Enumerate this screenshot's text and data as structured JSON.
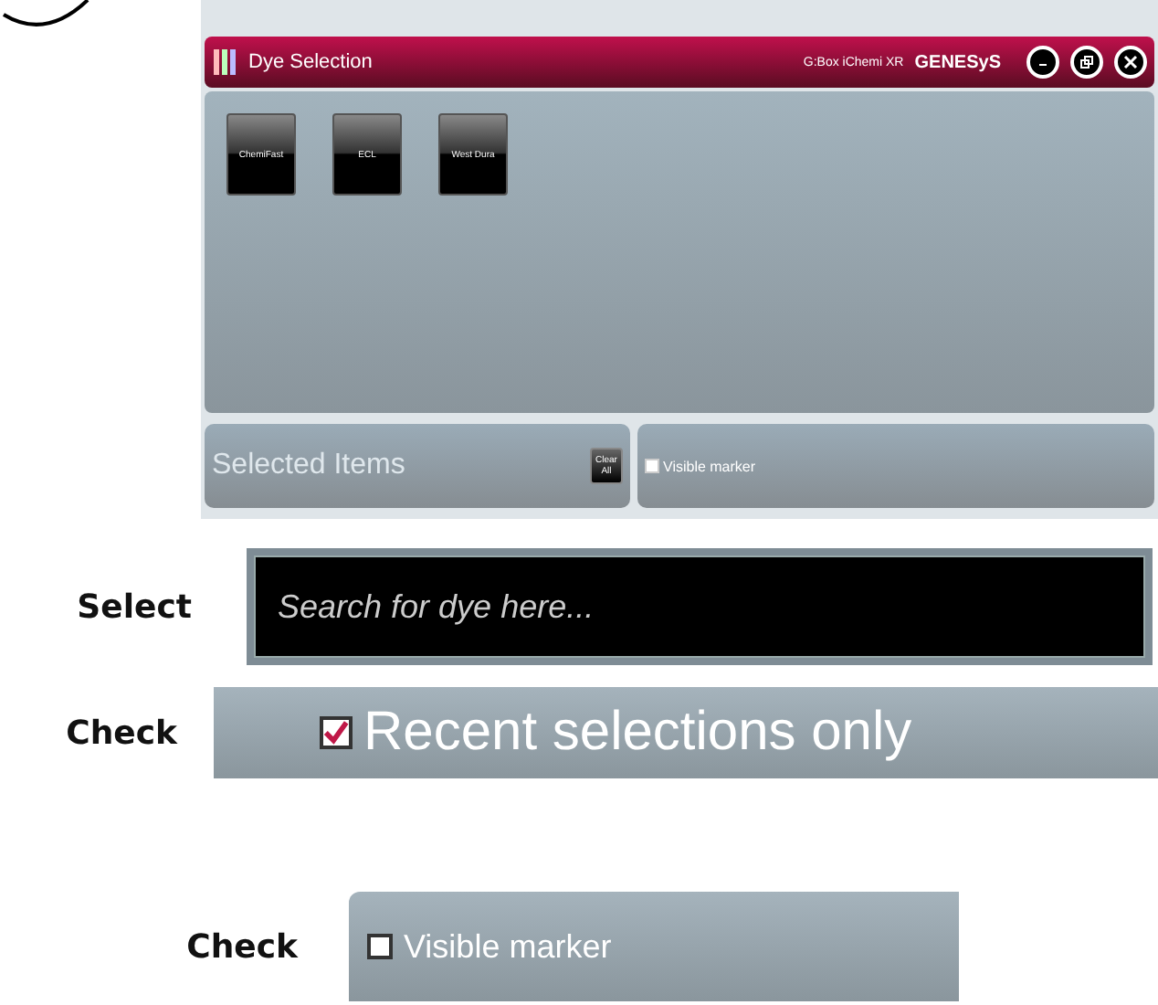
{
  "window": {
    "title": "Dye Selection",
    "product": "G:Box iChemi XR",
    "brand": "GENESyS"
  },
  "dyes": [
    {
      "label": "ChemiFast"
    },
    {
      "label": "ECL"
    },
    {
      "label": "West Dura"
    }
  ],
  "selected_items": {
    "placeholder": "Selected Items",
    "clear_button": "Clear All"
  },
  "visible_marker": {
    "label": "Visible marker",
    "checked": false
  },
  "steps": [
    {
      "action": "Select",
      "kind": "search",
      "placeholder": "Search for dye here..."
    },
    {
      "action": "Check",
      "kind": "checkbox",
      "label": "Recent selections only",
      "checked": true
    },
    {
      "action": "Check",
      "kind": "marker",
      "label": "Visible marker",
      "checked": false
    }
  ]
}
